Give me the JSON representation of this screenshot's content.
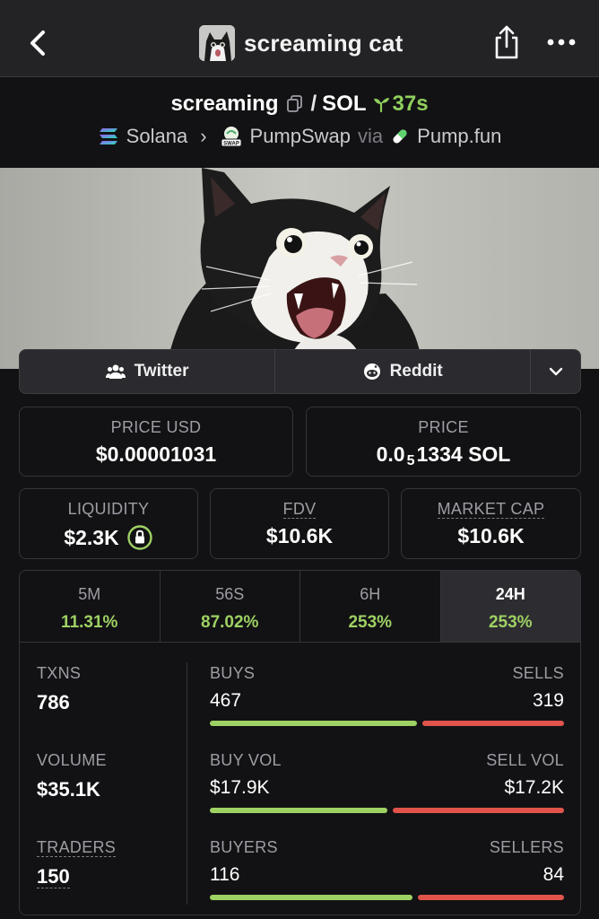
{
  "header": {
    "title": "screaming cat",
    "icons": {
      "back": "chevron-left-icon",
      "share": "share-icon",
      "more": "more-horizontal-icon"
    }
  },
  "pair": {
    "base": "screaming",
    "quote": "SOL",
    "age": "37s",
    "chain": "Solana",
    "dex": "PumpSwap",
    "via": "via",
    "launchpad": "Pump.fun"
  },
  "socials": {
    "twitter": "Twitter",
    "reddit": "Reddit"
  },
  "stats": {
    "price_usd_label": "PRICE USD",
    "price_usd": "$0.00001031",
    "price_label": "PRICE",
    "price_prefix": "0.0",
    "price_zeros": "5",
    "price_suffix": "1334 SOL",
    "liquidity_label": "LIQUIDITY",
    "liquidity": "$2.3K",
    "fdv_label": "FDV",
    "fdv": "$10.6K",
    "mcap_label": "MARKET CAP",
    "mcap": "$10.6K"
  },
  "timeframes": [
    {
      "label": "5M",
      "value": "11.31%"
    },
    {
      "label": "56S",
      "value": "87.02%"
    },
    {
      "label": "6H",
      "value": "253%"
    },
    {
      "label": "24H",
      "value": "253%"
    }
  ],
  "active_timeframe": "24H",
  "metrics": {
    "txns_label": "TXNS",
    "txns": "786",
    "volume_label": "VOLUME",
    "volume": "$35.1K",
    "traders_label": "TRADERS",
    "traders": "150",
    "buys_label": "BUYS",
    "buys": "467",
    "sells_label": "SELLS",
    "sells": "319",
    "buy_vol_label": "BUY VOL",
    "buy_vol": "$17.9K",
    "sell_vol_label": "SELL VOL",
    "sell_vol": "$17.2K",
    "buyers_label": "BUYERS",
    "buyers": "116",
    "sellers_label": "SELLERS",
    "sellers": "84",
    "buys_ratio": 0.594,
    "buy_vol_ratio": 0.51,
    "buyers_ratio": 0.58
  },
  "colors": {
    "positive": "#9ed163",
    "negative": "#e0544c",
    "background": "#121214",
    "surface": "#2b2b2f"
  }
}
